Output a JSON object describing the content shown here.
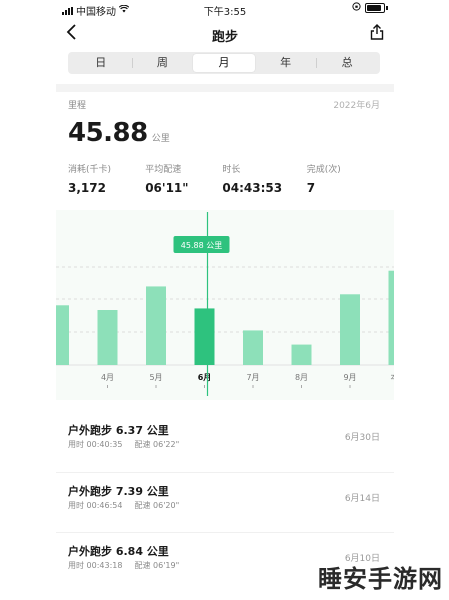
{
  "status_bar": {
    "carrier": "中国移动",
    "time": "下午3:55"
  },
  "nav": {
    "title": "跑步"
  },
  "tabs": [
    {
      "label": "日",
      "active": false
    },
    {
      "label": "周",
      "active": false
    },
    {
      "label": "月",
      "active": true
    },
    {
      "label": "年",
      "active": false
    },
    {
      "label": "总",
      "active": false
    }
  ],
  "summary": {
    "distance_label": "里程",
    "date": "2022年6月",
    "distance_value": "45.88",
    "distance_unit": "公里",
    "stats": [
      {
        "label": "消耗(千卡)",
        "value": "3,172"
      },
      {
        "label": "平均配速",
        "value": "06'11\""
      },
      {
        "label": "时长",
        "value": "04:43:53"
      },
      {
        "label": "完成(次)",
        "value": "7"
      }
    ]
  },
  "colors": {
    "bar": "#8de0b9",
    "bar_selected": "#2ec27e",
    "accent": "#2ec27e"
  },
  "chart_data": {
    "type": "bar",
    "categories": [
      "",
      "4月",
      "5月",
      "6月",
      "7月",
      "8月",
      "9月",
      "本月"
    ],
    "values": [
      38,
      35,
      50,
      36,
      22,
      13,
      45,
      60
    ],
    "selected_index": 3,
    "tooltip": "45.88 公里",
    "grid": true
  },
  "records": [
    {
      "title": "户外跑步 6.37 公里",
      "duration_label": "用时 00:40:35",
      "pace_label": "配速 06'22\"",
      "date": "6月30日"
    },
    {
      "title": "户外跑步 7.39 公里",
      "duration_label": "用时 00:46:54",
      "pace_label": "配速 06'20\"",
      "date": "6月14日"
    },
    {
      "title": "户外跑步 6.84 公里",
      "duration_label": "用时 00:43:18",
      "pace_label": "配速 06'19\"",
      "date": "6月10日"
    }
  ],
  "watermark": "睡安手游网"
}
